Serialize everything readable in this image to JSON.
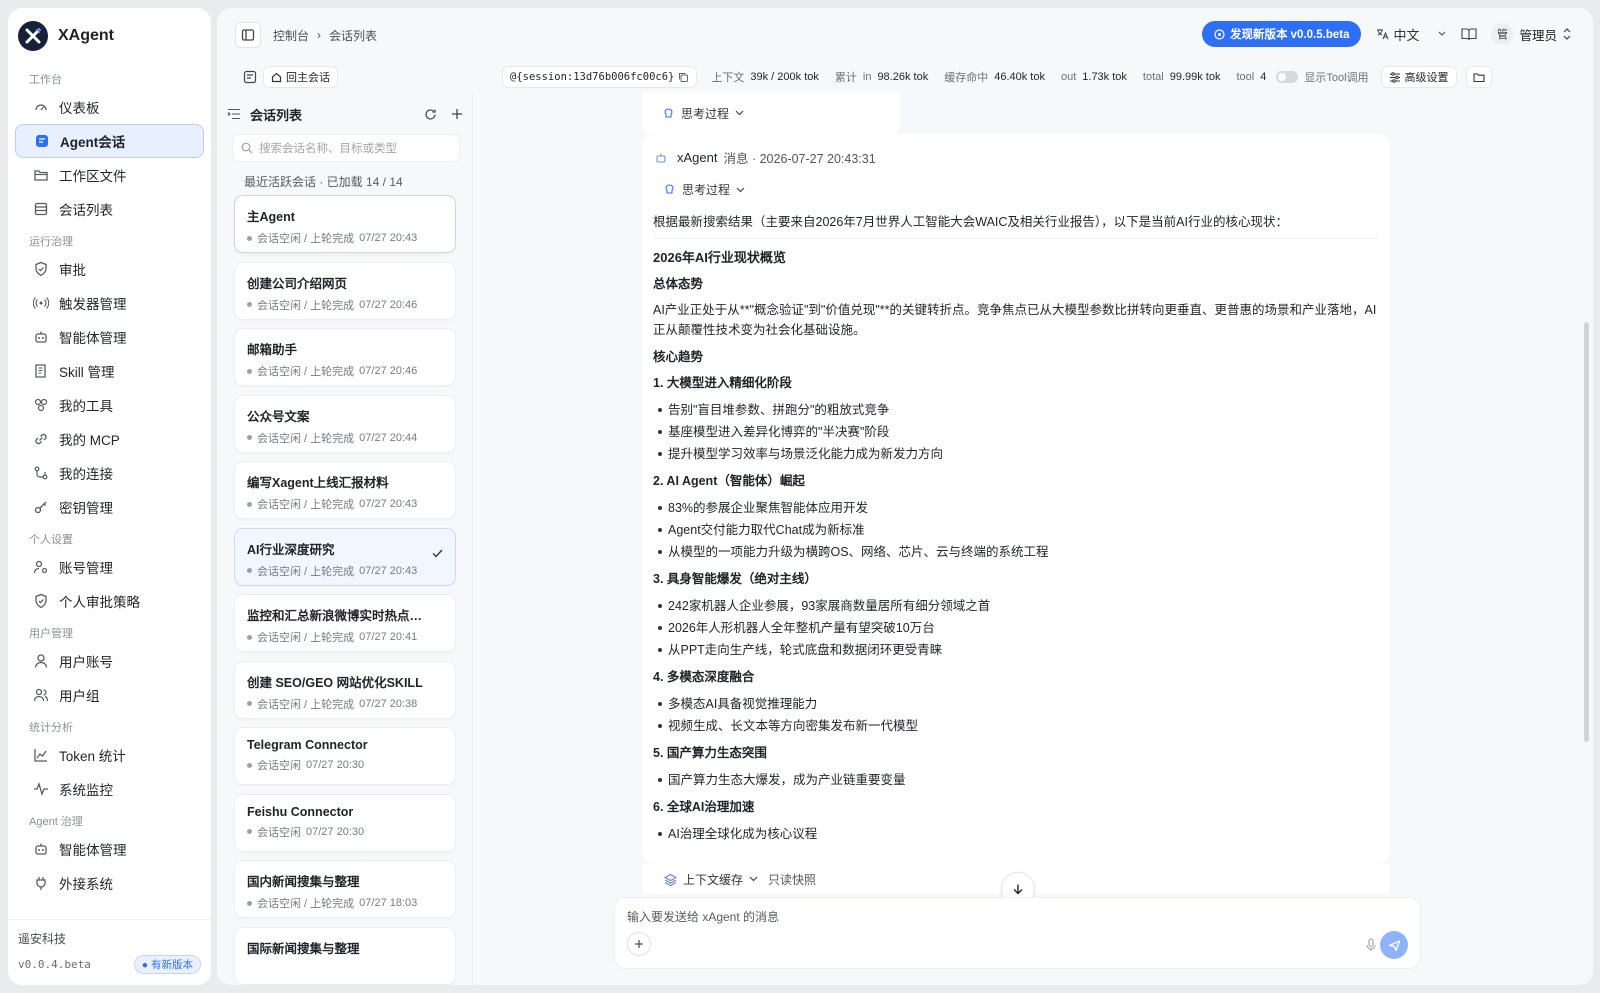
{
  "app": {
    "name": "XAgent",
    "org": "遥安科技",
    "version": "v0.0.4.beta",
    "update_badge": "有新版本"
  },
  "colors": {
    "accent": "#2f6ff5",
    "sidebar_active_bg": "#e8efff",
    "page_bg": "#e9ebef"
  },
  "sidebar": {
    "groups": [
      {
        "heading": "工作台",
        "items": [
          {
            "label": "仪表板",
            "icon": "gauge-icon"
          },
          {
            "label": "Agent会话",
            "icon": "chat-icon",
            "active": true
          },
          {
            "label": "工作区文件",
            "icon": "folder-icon"
          },
          {
            "label": "会话列表",
            "icon": "list-icon"
          }
        ]
      },
      {
        "heading": "运行治理",
        "items": [
          {
            "label": "审批",
            "icon": "shield-icon"
          },
          {
            "label": "触发器管理",
            "icon": "trigger-icon"
          },
          {
            "label": "智能体管理",
            "icon": "robot-icon"
          },
          {
            "label": "Skill 管理",
            "icon": "book-icon"
          },
          {
            "label": "我的工具",
            "icon": "tools-icon"
          },
          {
            "label": "我的 MCP",
            "icon": "link-icon"
          },
          {
            "label": "我的连接",
            "icon": "connection-icon"
          },
          {
            "label": "密钥管理",
            "icon": "key-icon"
          }
        ]
      },
      {
        "heading": "个人设置",
        "items": [
          {
            "label": "账号管理",
            "icon": "user-gear-icon"
          },
          {
            "label": "个人审批策略",
            "icon": "shield-check-icon"
          }
        ]
      },
      {
        "heading": "用户管理",
        "items": [
          {
            "label": "用户账号",
            "icon": "user-icon"
          },
          {
            "label": "用户组",
            "icon": "users-icon"
          }
        ]
      },
      {
        "heading": "统计分析",
        "items": [
          {
            "label": "Token 统计",
            "icon": "chart-icon"
          },
          {
            "label": "系统监控",
            "icon": "pulse-icon"
          }
        ]
      },
      {
        "heading": "Agent 治理",
        "items": [
          {
            "label": "智能体管理",
            "icon": "robot-icon"
          },
          {
            "label": "外接系统",
            "icon": "plug-icon"
          }
        ]
      }
    ]
  },
  "topbar": {
    "breadcrumb": [
      "控制台",
      "会话列表"
    ],
    "new_version_label": "发现新版本 v0.0.5.beta",
    "language": "中文",
    "user_avatar": "管",
    "user_name": "管理员"
  },
  "statbar": {
    "back_label": "回主会话",
    "session_ref": "@{session:13d76b006fc00c6}",
    "context_label": "上下文",
    "context_value": "39k / 200k tok",
    "cumulative_label": "累计",
    "in_label": "in",
    "in_value": "98.26k tok",
    "cache_label": "缓存命中",
    "cache_value": "46.40k tok",
    "out_label": "out",
    "out_value": "1.73k tok",
    "total_label": "total",
    "total_value": "99.99k tok",
    "tool_label": "tool",
    "tool_value": "4",
    "show_tool_label": "显示Tool调用",
    "advanced_label": "高级设置"
  },
  "sessions": {
    "title": "会话列表",
    "search_placeholder": "搜索会话名称、目标或类型",
    "recent_label": "最近活跃会话 · 已加载 14 / 14",
    "items": [
      {
        "title": "主Agent",
        "status": "会话空闲 / 上轮完成",
        "time": "07/27 20:43"
      },
      {
        "title": "创建公司介绍网页",
        "status": "会话空闲 / 上轮完成",
        "time": "07/27 20:46"
      },
      {
        "title": "邮箱助手",
        "status": "会话空闲 / 上轮完成",
        "time": "07/27 20:46"
      },
      {
        "title": "公众号文案",
        "status": "会话空闲 / 上轮完成",
        "time": "07/27 20:44"
      },
      {
        "title": "编写Xagent上线汇报材料",
        "status": "会话空闲 / 上轮完成",
        "time": "07/27 20:43"
      },
      {
        "title": "AI行业深度研究",
        "status": "会话空闲 / 上轮完成",
        "time": "07/27 20:43",
        "selected": true
      },
      {
        "title": "监控和汇总新浪微博实时热点与...",
        "status": "会话空闲 / 上轮完成",
        "time": "07/27 20:41"
      },
      {
        "title": "创建 SEO/GEO 网站优化SKILL",
        "status": "会话空闲 / 上轮完成",
        "time": "07/27 20:38"
      },
      {
        "title": "Telegram Connector",
        "status": "会话空闲",
        "time": "07/27 20:30"
      },
      {
        "title": "Feishu Connector",
        "status": "会话空闲",
        "time": "07/27 20:30"
      },
      {
        "title": "国内新闻搜集与整理",
        "status": "会话空闲 / 上轮完成",
        "time": "07/27 18:03"
      },
      {
        "title": "国际新闻搜集与整理",
        "status": "",
        "time": ""
      }
    ]
  },
  "chat": {
    "think_label": "思考过程",
    "message": {
      "author": "xAgent",
      "meta": "消息 · 2026-07-27 20:43:31",
      "intro": "根据最新搜索结果（主要来自2026年7月世界人工智能大会WAIC及相关行业报告），以下是当前AI行业的核心现状：",
      "title": "2026年AI行业现状概览",
      "overall_heading": "总体态势",
      "overall_text": "AI产业正处于从**\"概念验证\"到\"价值兑现\"**的关键转折点。竞争焦点已从大模型参数比拼转向更垂直、更普惠的场景和产业落地，AI正从颠覆性技术变为社会化基础设施。",
      "trends_heading": "核心趋势",
      "sections": [
        {
          "heading": "1. 大模型进入精细化阶段",
          "bullets": [
            "告别\"盲目堆参数、拼跑分\"的粗放式竞争",
            "基座模型进入差异化博弈的\"半决赛\"阶段",
            "提升模型学习效率与场景泛化能力成为新发力方向"
          ]
        },
        {
          "heading": "2. AI Agent（智能体）崛起",
          "bullets": [
            "83%的参展企业聚焦智能体应用开发",
            "Agent交付能力取代Chat成为新标准",
            "从模型的一项能力升级为横跨OS、网络、芯片、云与终端的系统工程"
          ]
        },
        {
          "heading": "3. 具身智能爆发（绝对主线）",
          "bullets": [
            "242家机器人企业参展，93家展商数量居所有细分领域之首",
            "2026年人形机器人全年整机产量有望突破10万台",
            "从PPT走向生产线，轮式底盘和数据闭环更受青睐"
          ]
        },
        {
          "heading": "4. 多模态深度融合",
          "bullets": [
            "多模态AI具备视觉推理能力",
            "视频生成、长文本等方向密集发布新一代模型"
          ]
        },
        {
          "heading": "5. 国产算力生态突围",
          "bullets": [
            "国产算力生态大爆发，成为产业链重要变量"
          ]
        },
        {
          "heading": "6. 全球AI治理加速",
          "bullets": [
            "AI治理全球化成为核心议程"
          ]
        }
      ]
    },
    "context_cache_label": "上下文缓存",
    "readonly_label": "只读快照",
    "composer_placeholder": "输入要发送给 xAgent 的消息"
  }
}
